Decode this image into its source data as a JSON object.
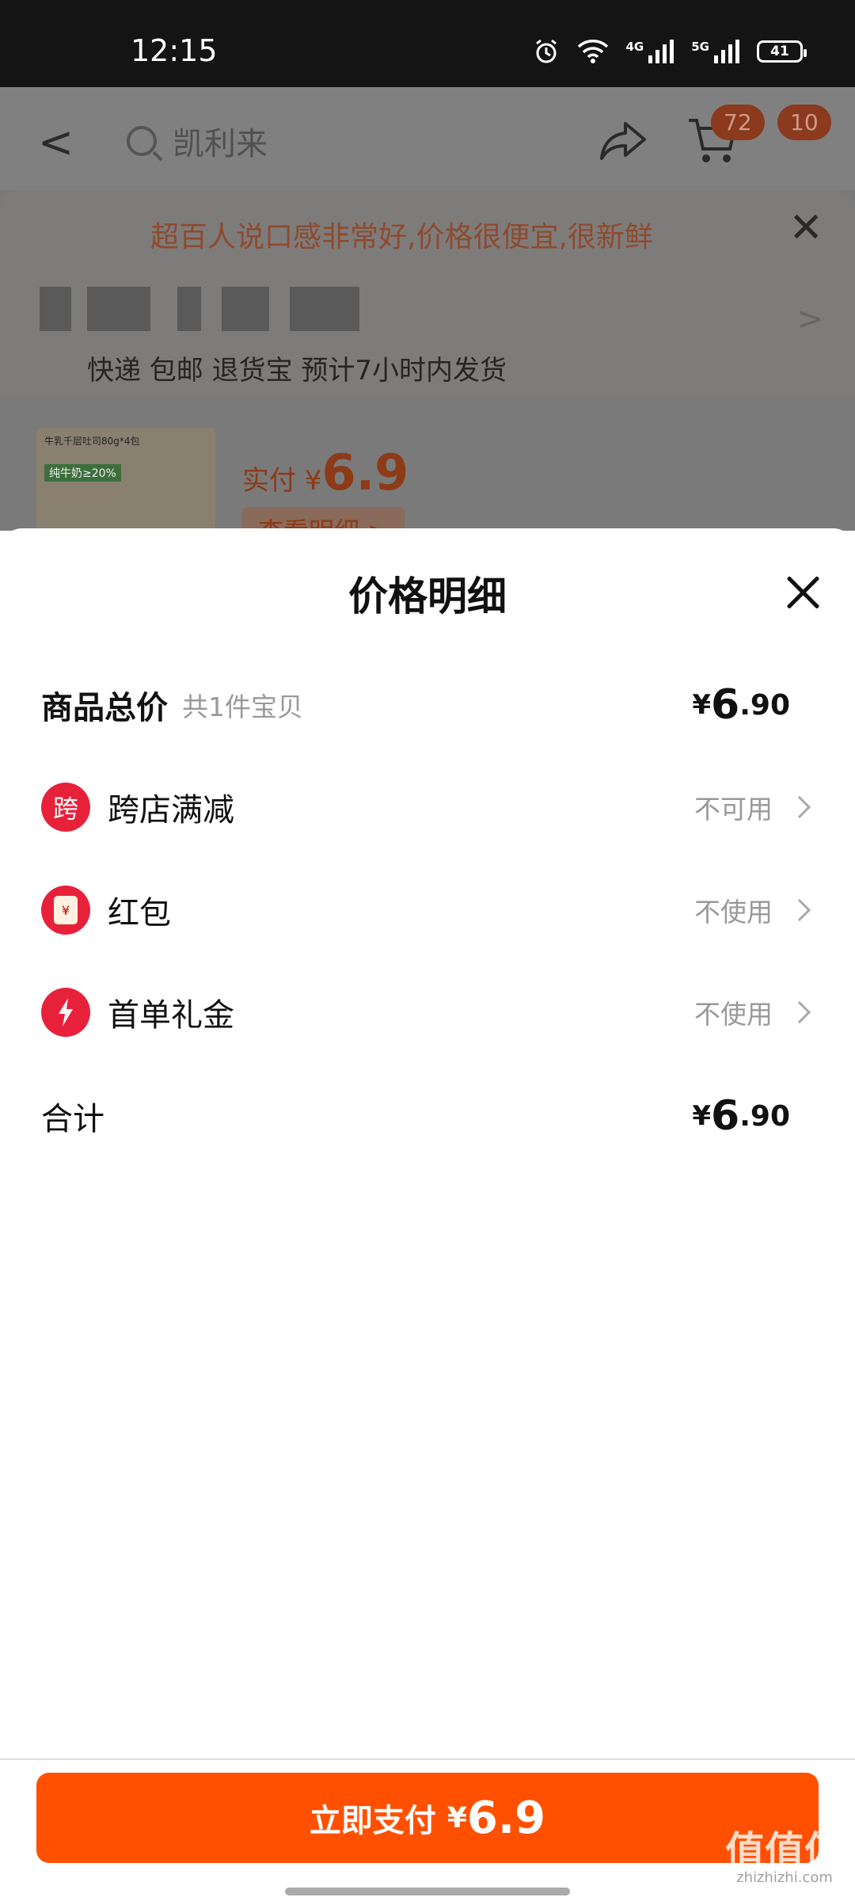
{
  "status_bar": {
    "time": "12:15",
    "net1": "4G",
    "net2": "5G",
    "battery": "41"
  },
  "background": {
    "search_text": "凯利来",
    "cart_badge": "72",
    "msg_badge": "10",
    "tip_text": "超百人说口感非常好,价格很便宜,很新鲜",
    "shipping_text": "快递 包邮 退货宝 预计7小时内发货",
    "product_thumb_title": "牛乳千层吐司80g*4包",
    "product_thumb_tag": "纯牛奶≥20%",
    "pay_label": "实付 ¥",
    "pay_value": "6.9",
    "detail_link": "查看明细 >"
  },
  "sheet": {
    "title": "价格明细",
    "rows": [
      {
        "label": "商品总价",
        "sub": "共1件宝贝",
        "price_cur": "¥",
        "price_int": "6",
        "price_dec": ".90"
      },
      {
        "label": "跨店满减",
        "icon_text": "跨",
        "status": "不可用"
      },
      {
        "label": "红包",
        "icon_text": "¥",
        "status": "不使用"
      },
      {
        "label": "首单礼金",
        "status": "不使用"
      },
      {
        "label": "合计",
        "price_cur": "¥",
        "price_int": "6",
        "price_dec": ".90"
      }
    ],
    "pay_button": {
      "label": "立即支付",
      "currency": "¥",
      "value": "6.9"
    }
  },
  "watermark": {
    "glyphs": "值值值",
    "url": "zhizhizhi.com"
  },
  "colors": {
    "accent": "#ff5000",
    "icon_red": "#e8213b"
  }
}
